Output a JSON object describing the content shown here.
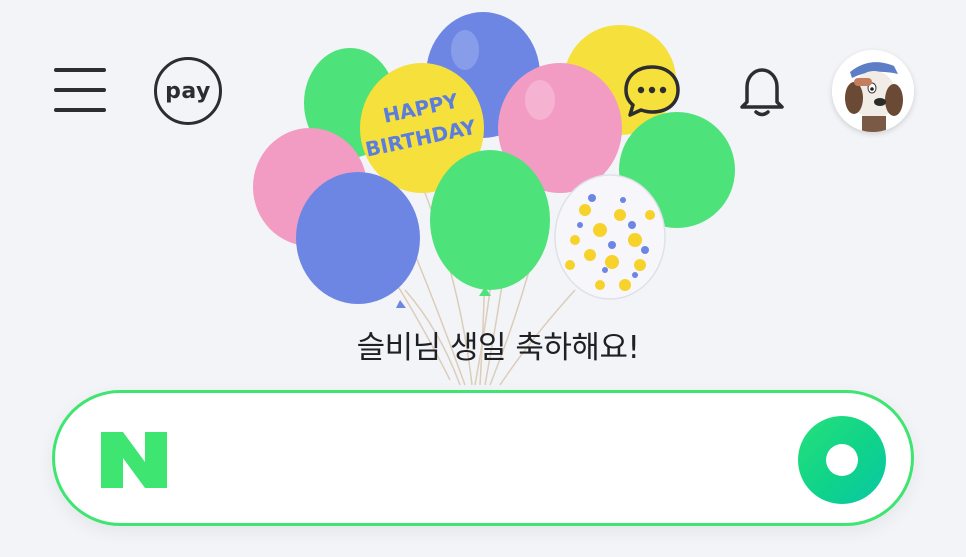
{
  "header": {
    "menu_icon": "hamburger-menu-icon",
    "pay_label": "pay",
    "talk_icon": "chat-bubble-icon",
    "notification_icon": "bell-icon",
    "avatar_icon": "profile-avatar-icon"
  },
  "doodle": {
    "balloon_text_line1": "HAPPY",
    "balloon_text_line2": "BIRTHDAY"
  },
  "greeting": "슬비님 생일 축하해요!",
  "search": {
    "placeholder": "",
    "value": "",
    "logo_icon": "naver-n-logo-icon",
    "submit_icon": "green-search-circle-icon"
  },
  "colors": {
    "accent": "#03c75a",
    "border_green": "#3ee571",
    "balloon_blue": "#6e86e3",
    "balloon_green": "#4ee27a",
    "balloon_pink": "#f29bc3",
    "balloon_yellow": "#f6e03b"
  }
}
